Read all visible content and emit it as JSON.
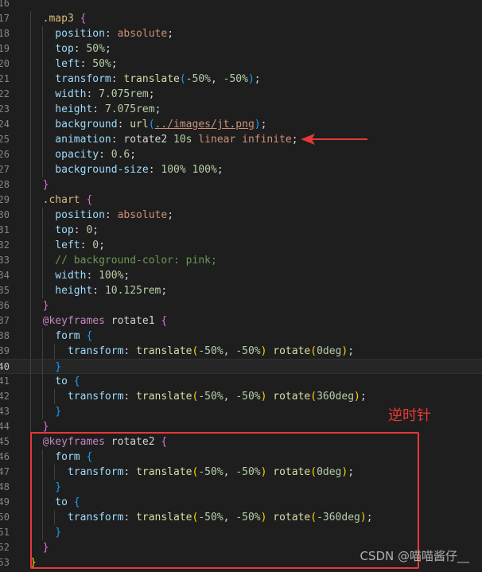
{
  "editor": {
    "language": "css",
    "lines": [
      {
        "num": "16",
        "tokens": []
      },
      {
        "num": "17",
        "tokens": [
          [
            "t-sel",
            "  .map3 "
          ],
          [
            "t-br1",
            "{"
          ]
        ]
      },
      {
        "num": "18",
        "tokens": [
          [
            "t-prop",
            "    position"
          ],
          [
            "t-pun",
            ": "
          ],
          [
            "t-val",
            "absolute"
          ],
          [
            "t-pun",
            ";"
          ]
        ]
      },
      {
        "num": "19",
        "tokens": [
          [
            "t-prop",
            "    top"
          ],
          [
            "t-pun",
            ": "
          ],
          [
            "t-num",
            "50%"
          ],
          [
            "t-pun",
            ";"
          ]
        ]
      },
      {
        "num": "20",
        "tokens": [
          [
            "t-prop",
            "    left"
          ],
          [
            "t-pun",
            ": "
          ],
          [
            "t-num",
            "50%"
          ],
          [
            "t-pun",
            ";"
          ]
        ]
      },
      {
        "num": "21",
        "tokens": [
          [
            "t-prop",
            "    transform"
          ],
          [
            "t-pun",
            ": "
          ],
          [
            "t-fn",
            "translate"
          ],
          [
            "t-br2",
            "("
          ],
          [
            "t-num",
            "-50%"
          ],
          [
            "t-pun",
            ", "
          ],
          [
            "t-num",
            "-50%"
          ],
          [
            "t-br2",
            ")"
          ],
          [
            "t-pun",
            ";"
          ]
        ]
      },
      {
        "num": "22",
        "tokens": [
          [
            "t-prop",
            "    width"
          ],
          [
            "t-pun",
            ": "
          ],
          [
            "t-num",
            "7.075rem"
          ],
          [
            "t-pun",
            ";"
          ]
        ]
      },
      {
        "num": "23",
        "tokens": [
          [
            "t-prop",
            "    height"
          ],
          [
            "t-pun",
            ": "
          ],
          [
            "t-num",
            "7.075rem"
          ],
          [
            "t-pun",
            ";"
          ]
        ]
      },
      {
        "num": "24",
        "tokens": [
          [
            "t-prop",
            "    background"
          ],
          [
            "t-pun",
            ": "
          ],
          [
            "t-fn",
            "url"
          ],
          [
            "t-br2",
            "("
          ],
          [
            "t-url",
            "../images/jt.png"
          ],
          [
            "t-br2",
            ")"
          ],
          [
            "t-pun",
            ";"
          ]
        ]
      },
      {
        "num": "25",
        "tokens": [
          [
            "t-prop",
            "    animation"
          ],
          [
            "t-pun",
            ": "
          ],
          [
            "t-pun",
            "rotate2 "
          ],
          [
            "t-num",
            "10s"
          ],
          [
            "t-val",
            " linear infinite"
          ],
          [
            "t-pun",
            ";"
          ]
        ]
      },
      {
        "num": "26",
        "tokens": [
          [
            "t-prop",
            "    opacity"
          ],
          [
            "t-pun",
            ": "
          ],
          [
            "t-num",
            "0.6"
          ],
          [
            "t-pun",
            ";"
          ]
        ]
      },
      {
        "num": "27",
        "tokens": [
          [
            "t-prop",
            "    background-size"
          ],
          [
            "t-pun",
            ": "
          ],
          [
            "t-num",
            "100% 100%"
          ],
          [
            "t-pun",
            ";"
          ]
        ]
      },
      {
        "num": "28",
        "tokens": [
          [
            "t-br1",
            "  }"
          ]
        ]
      },
      {
        "num": "29",
        "tokens": [
          [
            "t-sel",
            "  .chart "
          ],
          [
            "t-br1",
            "{"
          ]
        ]
      },
      {
        "num": "30",
        "tokens": [
          [
            "t-prop",
            "    position"
          ],
          [
            "t-pun",
            ": "
          ],
          [
            "t-val",
            "absolute"
          ],
          [
            "t-pun",
            ";"
          ]
        ]
      },
      {
        "num": "31",
        "tokens": [
          [
            "t-prop",
            "    top"
          ],
          [
            "t-pun",
            ": "
          ],
          [
            "t-num",
            "0"
          ],
          [
            "t-pun",
            ";"
          ]
        ]
      },
      {
        "num": "32",
        "tokens": [
          [
            "t-prop",
            "    left"
          ],
          [
            "t-pun",
            ": "
          ],
          [
            "t-num",
            "0"
          ],
          [
            "t-pun",
            ";"
          ]
        ]
      },
      {
        "num": "33",
        "tokens": [
          [
            "t-com",
            "    // background-color: pink;"
          ]
        ]
      },
      {
        "num": "34",
        "tokens": [
          [
            "t-prop",
            "    width"
          ],
          [
            "t-pun",
            ": "
          ],
          [
            "t-num",
            "100%"
          ],
          [
            "t-pun",
            ";"
          ]
        ]
      },
      {
        "num": "35",
        "tokens": [
          [
            "t-prop",
            "    height"
          ],
          [
            "t-pun",
            ": "
          ],
          [
            "t-num",
            "10.125rem"
          ],
          [
            "t-pun",
            ";"
          ]
        ]
      },
      {
        "num": "36",
        "tokens": [
          [
            "t-br1",
            "  }"
          ]
        ]
      },
      {
        "num": "37",
        "tokens": [
          [
            "t-at",
            "  @keyframes"
          ],
          [
            "t-pun",
            " rotate1 "
          ],
          [
            "t-br1",
            "{"
          ]
        ]
      },
      {
        "num": "38",
        "tokens": [
          [
            "t-kw",
            "    form "
          ],
          [
            "t-br2",
            "{"
          ]
        ]
      },
      {
        "num": "39",
        "tokens": [
          [
            "t-prop",
            "      transform"
          ],
          [
            "t-pun",
            ": "
          ],
          [
            "t-fn",
            "translate"
          ],
          [
            "t-br3",
            "("
          ],
          [
            "t-num",
            "-50%"
          ],
          [
            "t-pun",
            ", "
          ],
          [
            "t-num",
            "-50%"
          ],
          [
            "t-br3",
            ")"
          ],
          [
            "t-fn",
            " rotate"
          ],
          [
            "t-br3",
            "("
          ],
          [
            "t-num",
            "0deg"
          ],
          [
            "t-br3",
            ")"
          ],
          [
            "t-pun",
            ";"
          ]
        ]
      },
      {
        "num": "40",
        "tokens": [
          [
            "t-br2",
            "    }"
          ]
        ]
      },
      {
        "num": "41",
        "tokens": [
          [
            "t-kw",
            "    to "
          ],
          [
            "t-br2",
            "{"
          ]
        ]
      },
      {
        "num": "42",
        "tokens": [
          [
            "t-prop",
            "      transform"
          ],
          [
            "t-pun",
            ": "
          ],
          [
            "t-fn",
            "translate"
          ],
          [
            "t-br3",
            "("
          ],
          [
            "t-num",
            "-50%"
          ],
          [
            "t-pun",
            ", "
          ],
          [
            "t-num",
            "-50%"
          ],
          [
            "t-br3",
            ")"
          ],
          [
            "t-fn",
            " rotate"
          ],
          [
            "t-br3",
            "("
          ],
          [
            "t-num",
            "360deg"
          ],
          [
            "t-br3",
            ")"
          ],
          [
            "t-pun",
            ";"
          ]
        ]
      },
      {
        "num": "43",
        "tokens": [
          [
            "t-br2",
            "    }"
          ]
        ]
      },
      {
        "num": "44",
        "tokens": [
          [
            "t-br1",
            "  }"
          ]
        ]
      },
      {
        "num": "45",
        "tokens": [
          [
            "t-at",
            "  @keyframes"
          ],
          [
            "t-pun",
            " rotate2 "
          ],
          [
            "t-br1",
            "{"
          ]
        ]
      },
      {
        "num": "46",
        "tokens": [
          [
            "t-kw",
            "    form "
          ],
          [
            "t-br2",
            "{"
          ]
        ]
      },
      {
        "num": "47",
        "tokens": [
          [
            "t-prop",
            "      transform"
          ],
          [
            "t-pun",
            ": "
          ],
          [
            "t-fn",
            "translate"
          ],
          [
            "t-br3",
            "("
          ],
          [
            "t-num",
            "-50%"
          ],
          [
            "t-pun",
            ", "
          ],
          [
            "t-num",
            "-50%"
          ],
          [
            "t-br3",
            ")"
          ],
          [
            "t-fn",
            " rotate"
          ],
          [
            "t-br3",
            "("
          ],
          [
            "t-num",
            "0deg"
          ],
          [
            "t-br3",
            ")"
          ],
          [
            "t-pun",
            ";"
          ]
        ]
      },
      {
        "num": "48",
        "tokens": [
          [
            "t-br2",
            "    }"
          ]
        ]
      },
      {
        "num": "49",
        "tokens": [
          [
            "t-kw",
            "    to "
          ],
          [
            "t-br2",
            "{"
          ]
        ]
      },
      {
        "num": "50",
        "tokens": [
          [
            "t-prop",
            "      transform"
          ],
          [
            "t-pun",
            ": "
          ],
          [
            "t-fn",
            "translate"
          ],
          [
            "t-br3",
            "("
          ],
          [
            "t-num",
            "-50%"
          ],
          [
            "t-pun",
            ", "
          ],
          [
            "t-num",
            "-50%"
          ],
          [
            "t-br3",
            ")"
          ],
          [
            "t-fn",
            " rotate"
          ],
          [
            "t-br3",
            "("
          ],
          [
            "t-num",
            "-360deg"
          ],
          [
            "t-br3",
            ")"
          ],
          [
            "t-pun",
            ";"
          ]
        ]
      },
      {
        "num": "51",
        "tokens": [
          [
            "t-br2",
            "    }"
          ]
        ]
      },
      {
        "num": "52",
        "tokens": [
          [
            "t-br1",
            "  }"
          ]
        ]
      },
      {
        "num": "53",
        "tokens": [
          [
            "t-br3",
            "}"
          ]
        ]
      }
    ],
    "current_line": "40"
  },
  "annotation": {
    "note": "逆时针",
    "color": "#e53935"
  },
  "watermark": "CSDN @喵喵酱仔__"
}
